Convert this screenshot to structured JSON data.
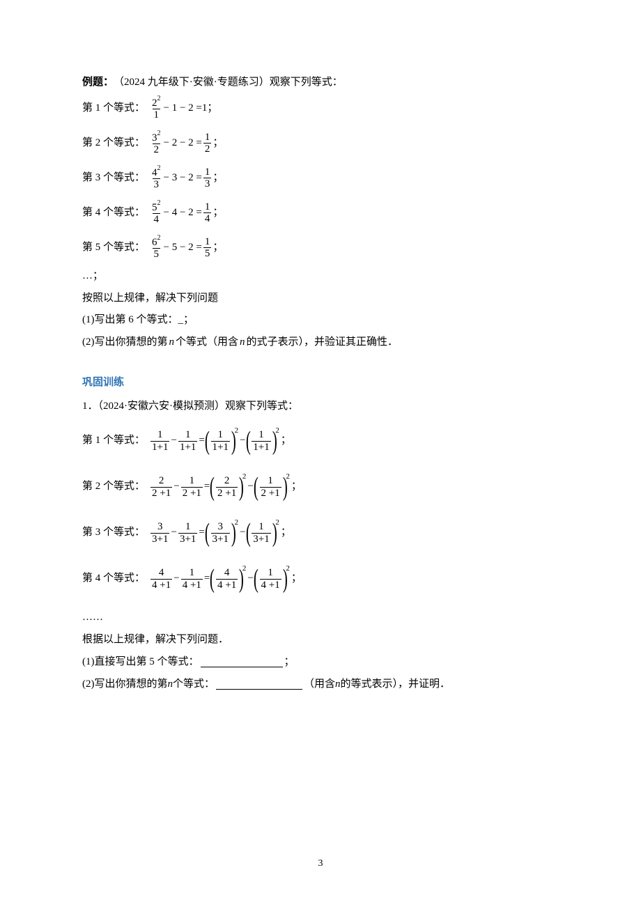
{
  "example": {
    "label_bold": "例题：",
    "source": "（2024 九年级下·安徽·专题练习）观察下列等式：",
    "eqs": [
      {
        "lead": "第 1 个等式：",
        "num": "2",
        "numexp": "2",
        "den": "1",
        "a": "1",
        "b": "2",
        "rhs_type": "int",
        "rhs": "1",
        "tail": "；"
      },
      {
        "lead": "第 2 个等式：",
        "num": "3",
        "numexp": "2",
        "den": "2",
        "a": "2",
        "b": "2",
        "rhs_type": "frac",
        "rn": "1",
        "rd": "2",
        "tail": "；"
      },
      {
        "lead": "第 3 个等式：",
        "num": "4",
        "numexp": "2",
        "den": "3",
        "a": "3",
        "b": "2",
        "rhs_type": "frac",
        "rn": "1",
        "rd": "3",
        "tail": "；"
      },
      {
        "lead": "第 4 个等式：",
        "num": "5",
        "numexp": "2",
        "den": "4",
        "a": "4",
        "b": "2",
        "rhs_type": "frac",
        "rn": "1",
        "rd": "4",
        "tail": "；"
      },
      {
        "lead": "第 5 个等式：",
        "num": "6",
        "numexp": "2",
        "den": "5",
        "a": "5",
        "b": "2",
        "rhs_type": "frac",
        "rn": "1",
        "rd": "5",
        "tail": "；"
      }
    ],
    "dots": "…；",
    "prompt": "按照以上规律，解决下列问题",
    "q1": "(1)写出第 6 个等式：_；",
    "q2_a": "(2)写出你猜想的第",
    "q2_n1": "n",
    "q2_b": "个等式（用含",
    "q2_n2": "n",
    "q2_c": "的式子表示），并验证其正确性．"
  },
  "training": {
    "title": "巩固训练",
    "p1_lead": "1．（2024·安徽六安·模拟预测）观察下列等式：",
    "eqs": [
      {
        "lead": "第 1 个等式：",
        "n": "1",
        "d": "1+1",
        "tail": "；"
      },
      {
        "lead": "第 2 个等式：",
        "n": "2",
        "d": "2 +1",
        "tail": "；"
      },
      {
        "lead": "第 3 个等式：",
        "n": "3",
        "d": "3+1",
        "tail": "；"
      },
      {
        "lead": "第 4 个等式：",
        "n": "4",
        "d": "4 +1",
        "tail": "；"
      }
    ],
    "dots": "……",
    "prompt": "根据以上规律，解决下列问题．",
    "q1_a": "(1)直接写出第 5 个等式：",
    "q1_b": "；",
    "q2_a": "(2)写出你猜想的第 ",
    "q2_n": "n",
    "q2_b": " 个等式：",
    "q2_c": "（用含 ",
    "q2_n2": "n",
    "q2_d": " 的等式表示），并证明．"
  },
  "page_number": "3"
}
